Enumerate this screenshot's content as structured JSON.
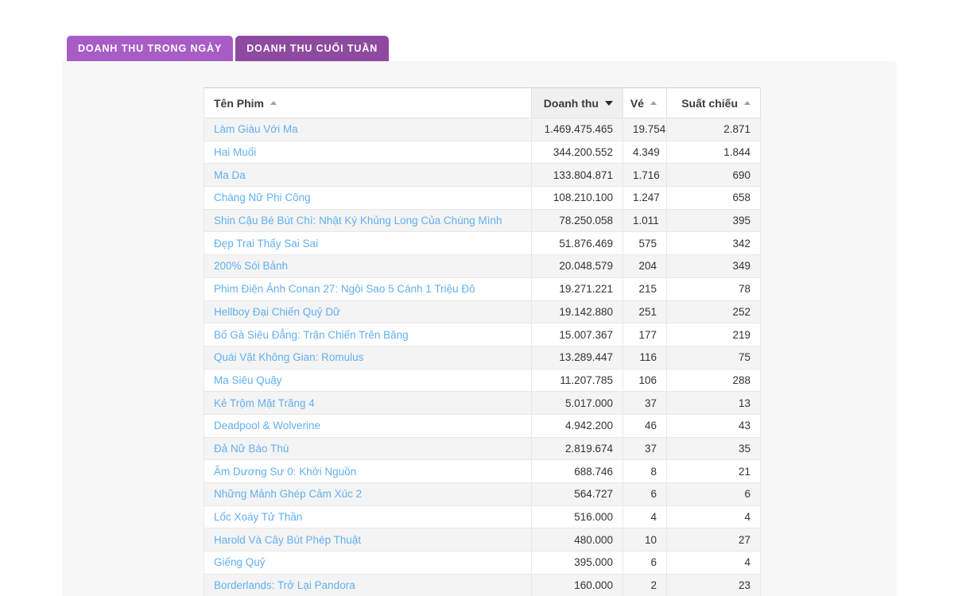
{
  "tabs": [
    {
      "label": "DOANH THU TRONG NGÀY",
      "active": true
    },
    {
      "label": "DOANH THU CUỐI TUẦN",
      "active": false
    }
  ],
  "colors": {
    "tab_active": "#a85cc6",
    "tab_inactive": "#8e4aa0",
    "link": "#61b0f2",
    "panel_bg": "#f7f7f7",
    "row_stripe": "#f4f4f4"
  },
  "table": {
    "columns": [
      {
        "label": "Tên Phim",
        "sort": "asc",
        "sorted": false,
        "align": "left"
      },
      {
        "label": "Doanh thu",
        "sort": "desc",
        "sorted": true,
        "align": "right"
      },
      {
        "label": "Vé",
        "sort": "asc",
        "sorted": false,
        "align": "right"
      },
      {
        "label": "Suất chiếu",
        "sort": "asc",
        "sorted": false,
        "align": "right"
      }
    ],
    "rows": [
      {
        "name": "Làm Giàu Với Ma",
        "revenue": "1.469.475.465",
        "tickets": "19.754",
        "shows": "2.871"
      },
      {
        "name": "Hai Muối",
        "revenue": "344.200.552",
        "tickets": "4.349",
        "shows": "1.844"
      },
      {
        "name": "Ma Da",
        "revenue": "133.804.871",
        "tickets": "1.716",
        "shows": "690"
      },
      {
        "name": "Chàng Nữ Phi Công",
        "revenue": "108.210.100",
        "tickets": "1.247",
        "shows": "658"
      },
      {
        "name": "Shin Cậu Bé Bút Chì: Nhật Ký Khủng Long Của Chúng Mình",
        "revenue": "78.250.058",
        "tickets": "1.011",
        "shows": "395"
      },
      {
        "name": "Đẹp Trai Thấy Sai Sai",
        "revenue": "51.876.469",
        "tickets": "575",
        "shows": "342"
      },
      {
        "name": "200% Sói Bảnh",
        "revenue": "20.048.579",
        "tickets": "204",
        "shows": "349"
      },
      {
        "name": "Phim Điện Ảnh Conan 27: Ngôi Sao 5 Cánh 1 Triệu Đô",
        "revenue": "19.271.221",
        "tickets": "215",
        "shows": "78"
      },
      {
        "name": "Hellboy Đại Chiến Quỷ Dữ",
        "revenue": "19.142.880",
        "tickets": "251",
        "shows": "252"
      },
      {
        "name": "Bố Gà Siêu Đẳng: Trận Chiến Trên Băng",
        "revenue": "15.007.367",
        "tickets": "177",
        "shows": "219"
      },
      {
        "name": "Quái Vật Không Gian: Romulus",
        "revenue": "13.289.447",
        "tickets": "116",
        "shows": "75"
      },
      {
        "name": "Ma Siêu Quậy",
        "revenue": "11.207.785",
        "tickets": "106",
        "shows": "288"
      },
      {
        "name": "Kẻ Trộm Mặt Trăng 4",
        "revenue": "5.017.000",
        "tickets": "37",
        "shows": "13"
      },
      {
        "name": "Deadpool & Wolverine",
        "revenue": "4.942.200",
        "tickets": "46",
        "shows": "43"
      },
      {
        "name": "Đả Nữ Báo Thù",
        "revenue": "2.819.674",
        "tickets": "37",
        "shows": "35"
      },
      {
        "name": "Âm Dương Sư 0: Khởi Nguồn",
        "revenue": "688.746",
        "tickets": "8",
        "shows": "21"
      },
      {
        "name": "Những Mảnh Ghép Cảm Xúc 2",
        "revenue": "564.727",
        "tickets": "6",
        "shows": "6"
      },
      {
        "name": "Lốc Xoáy Tử Thần",
        "revenue": "516.000",
        "tickets": "4",
        "shows": "4"
      },
      {
        "name": "Harold Và Cây Bút Phép Thuật",
        "revenue": "480.000",
        "tickets": "10",
        "shows": "27"
      },
      {
        "name": "Giếng Quỷ",
        "revenue": "395.000",
        "tickets": "6",
        "shows": "4"
      },
      {
        "name": "Borderlands: Trở Lại Pandora",
        "revenue": "160.000",
        "tickets": "2",
        "shows": "23"
      }
    ]
  }
}
